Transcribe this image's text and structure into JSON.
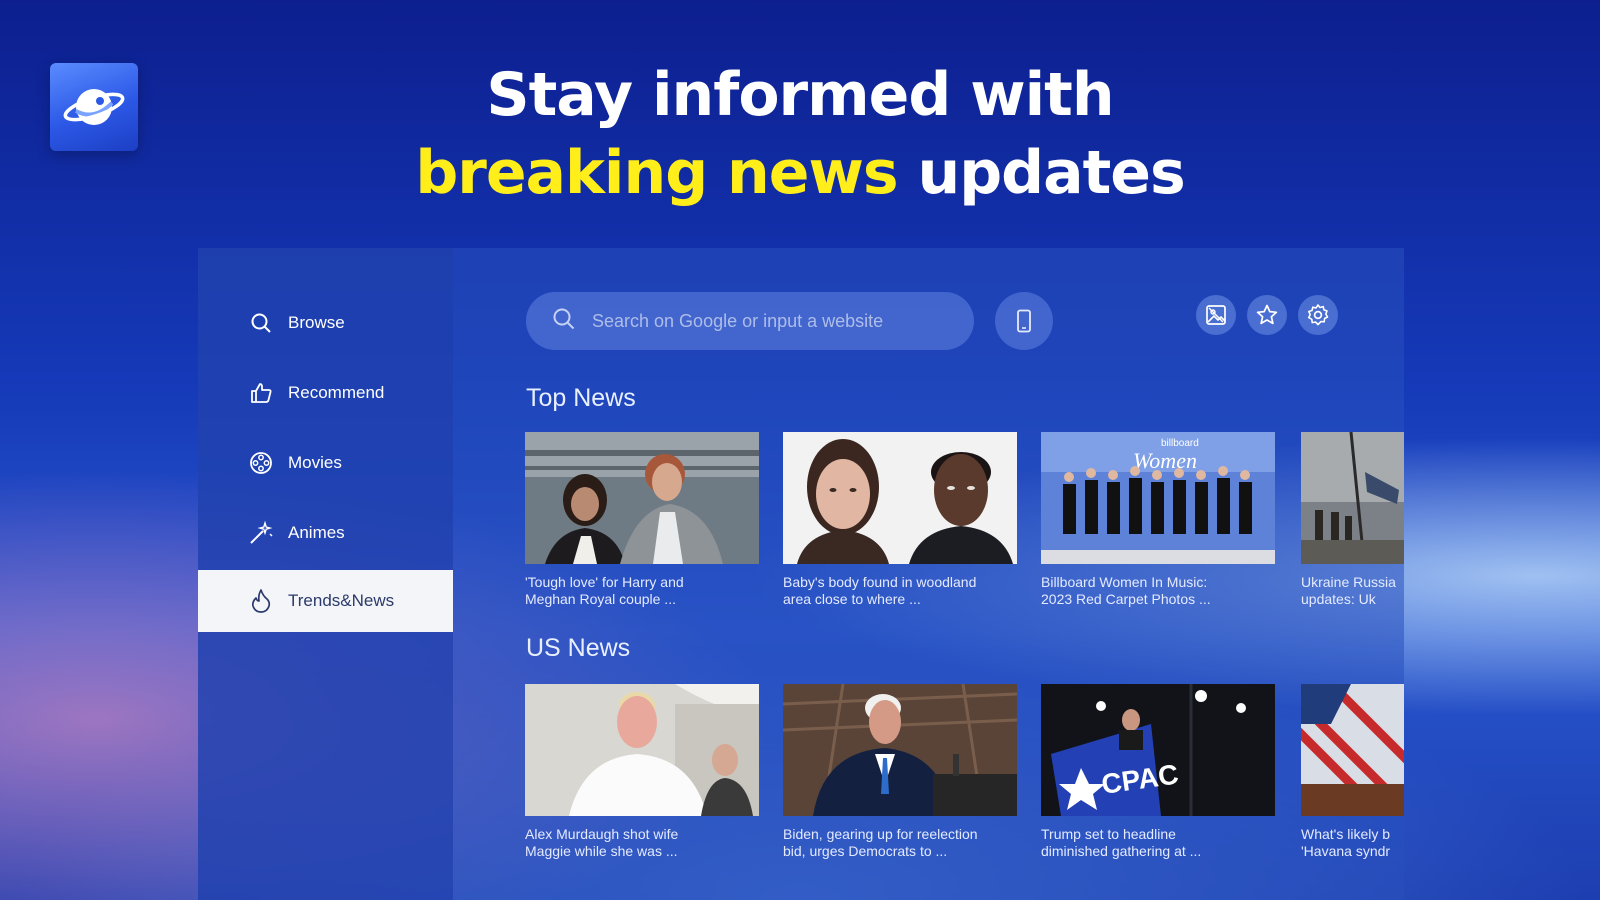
{
  "headline": {
    "line1": "Stay informed with",
    "line2_highlight": "breaking news",
    "line2_rest": " updates"
  },
  "colors": {
    "highlight": "#ffee1a",
    "active_nav_bg": "#f4f5f8"
  },
  "sidebar": {
    "items": [
      {
        "label": "Browse",
        "icon": "search-icon"
      },
      {
        "label": "Recommend",
        "icon": "thumbs-up-icon"
      },
      {
        "label": "Movies",
        "icon": "film-reel-icon"
      },
      {
        "label": "Animes",
        "icon": "magic-wand-icon"
      },
      {
        "label": "Trends&News",
        "icon": "flame-icon",
        "active": true
      }
    ]
  },
  "search": {
    "placeholder": "Search on Google or input a website"
  },
  "toolbar": {
    "icons": [
      "phone-icon",
      "image-icon",
      "star-icon",
      "gear-icon"
    ]
  },
  "sections": [
    {
      "title": "Top News",
      "cards": [
        {
          "line1": "'Tough love' for Harry and",
          "line2": "Meghan Royal couple ..."
        },
        {
          "line1": "Baby's body found in woodland",
          "line2": "area close to where ..."
        },
        {
          "line1": "Billboard Women In Music:",
          "line2": "2023 Red Carpet Photos ..."
        },
        {
          "line1": "Ukraine Russia",
          "line2": "updates: Uk"
        }
      ]
    },
    {
      "title": "US News",
      "cards": [
        {
          "line1": "Alex Murdaugh shot wife",
          "line2": "Maggie while she was ..."
        },
        {
          "line1": "Biden, gearing up for reelection",
          "line2": "bid, urges Democrats to ..."
        },
        {
          "line1": "Trump set to headline",
          "line2": "diminished gathering at ..."
        },
        {
          "line1": "What's likely b",
          "line2": "'Havana syndr"
        }
      ]
    }
  ],
  "thumb_texts": {
    "cpac": "CPAC",
    "billboard": "billboard",
    "women": "Women"
  }
}
